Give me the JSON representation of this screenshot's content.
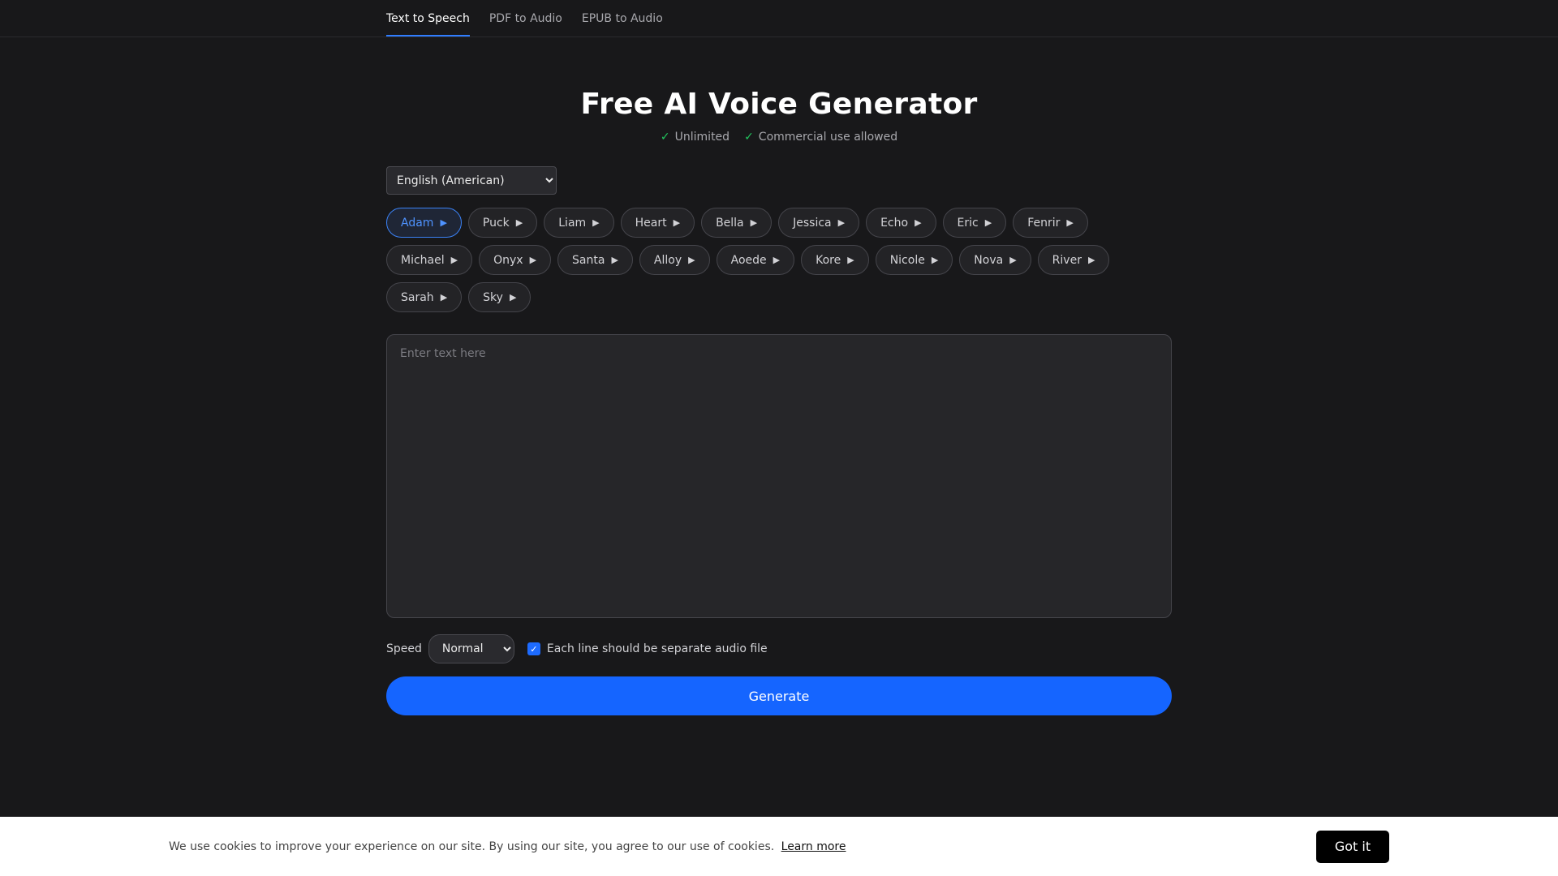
{
  "nav": {
    "tabs": [
      {
        "label": "Text to Speech"
      },
      {
        "label": "PDF to Audio"
      },
      {
        "label": "EPUB to Audio"
      }
    ]
  },
  "hero": {
    "title": "Free AI Voice Generator",
    "features": [
      "Unlimited",
      "Commercial use allowed"
    ]
  },
  "language": {
    "selected": "English (American)"
  },
  "voices": {
    "selected": "Adam",
    "items": [
      "Adam",
      "Puck",
      "Liam",
      "Heart",
      "Bella",
      "Jessica",
      "Echo",
      "Eric",
      "Fenrir",
      "Michael",
      "Onyx",
      "Santa",
      "Alloy",
      "Aoede",
      "Kore",
      "Nicole",
      "Nova",
      "River",
      "Sarah",
      "Sky"
    ]
  },
  "editor": {
    "placeholder": "Enter text here",
    "value": ""
  },
  "options": {
    "speed_label": "Speed",
    "speed_selected": "Normal",
    "separate_lines_label": "Each line should be separate audio file",
    "separate_lines_checked": true
  },
  "generate_label": "Generate",
  "cookie": {
    "text": "We use cookies to improve your experience on our site. By using our site, you agree to our use of cookies.",
    "link": "Learn more",
    "button": "Got it"
  },
  "colors": {
    "accent": "#1565ff",
    "selected_chip": "#3b82f6",
    "check": "#22c55e",
    "background": "#18181a"
  }
}
